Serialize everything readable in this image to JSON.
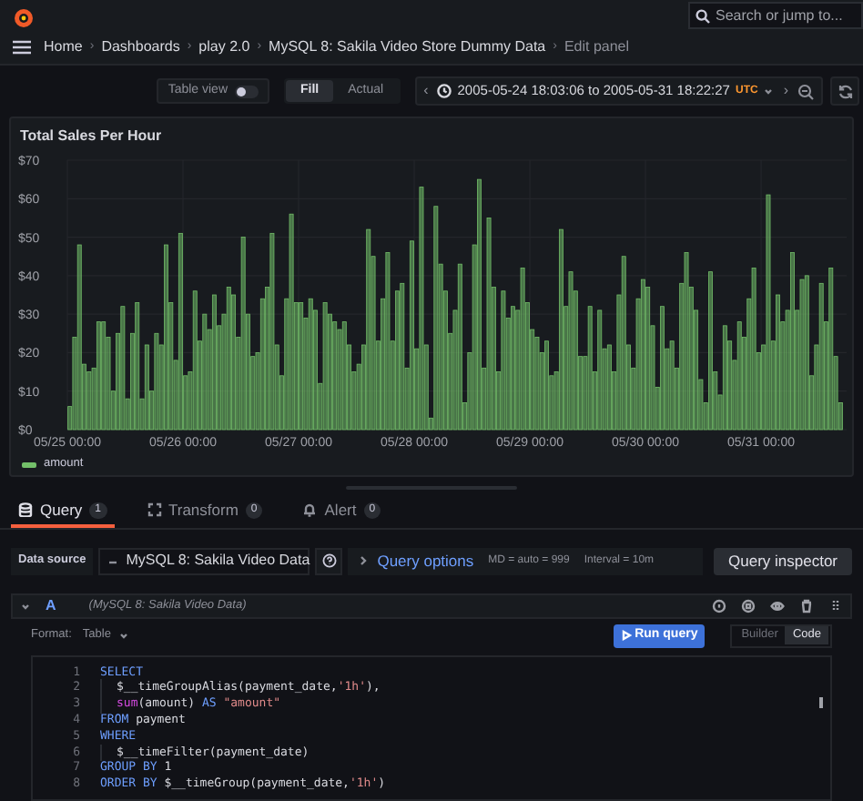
{
  "topbar": {
    "search": {
      "placeholder": "Search or jump to..."
    }
  },
  "breadcrumbs": [
    {
      "label": "Home"
    },
    {
      "separator": "›",
      "label": "Dashboards"
    },
    {
      "separator": "›",
      "label": "play 2.0"
    },
    {
      "separator": "›",
      "label": "MySQL 8: Sakila Video Store Dummy Data"
    },
    {
      "separator": "›",
      "label": "Edit panel"
    }
  ],
  "toolbar": {
    "table_view": {
      "label": "Table view",
      "on": false
    },
    "modes": [
      {
        "label": "Fill",
        "selected": true
      },
      {
        "label": "Actual",
        "selected": false
      }
    ],
    "time_range": {
      "prev": "‹",
      "text": "2005-05-24 18:03:06 to 2005-05-31 18:22:27",
      "timezone": "UTC",
      "next": "›"
    }
  },
  "panel": {
    "title": "Total Sales Per Hour",
    "chart_data": {
      "type": "bar",
      "categories": [
        "05/25 00:00",
        null,
        null,
        null,
        null,
        null,
        null,
        null,
        null,
        null,
        null,
        null,
        null,
        null,
        null,
        null,
        null,
        null,
        null,
        null,
        null,
        null,
        null,
        null,
        "05/26 00:00",
        null,
        null,
        null,
        null,
        null,
        null,
        null,
        null,
        null,
        null,
        null,
        null,
        null,
        null,
        null,
        null,
        null,
        null,
        null,
        null,
        null,
        null,
        null,
        "05/27 00:00",
        null,
        null,
        null,
        null,
        null,
        null,
        null,
        null,
        null,
        null,
        null,
        null,
        null,
        null,
        null,
        null,
        null,
        null,
        null,
        null,
        null,
        null,
        null,
        "05/28 00:00",
        null,
        null,
        null,
        null,
        null,
        null,
        null,
        null,
        null,
        null,
        null,
        null,
        null,
        null,
        null,
        null,
        null,
        null,
        null,
        null,
        null,
        null,
        null,
        "05/29 00:00",
        null,
        null,
        null,
        null,
        null,
        null,
        null,
        null,
        null,
        null,
        null,
        null,
        null,
        null,
        null,
        null,
        null,
        null,
        null,
        null,
        null,
        null,
        null,
        "05/30 00:00",
        null,
        null,
        null,
        null,
        null,
        null,
        null,
        null,
        null,
        null,
        null,
        null,
        null,
        null,
        null,
        null,
        null,
        null,
        null,
        null,
        null,
        null,
        null,
        "05/31 00:00",
        null,
        null,
        null,
        null,
        null,
        null,
        null,
        null,
        null,
        null,
        null,
        null,
        null,
        null,
        null,
        null
      ],
      "series": [
        {
          "name": "amount",
          "color": "#73bf69",
          "values": [
            6,
            24,
            48,
            17,
            15,
            16,
            28,
            28,
            24,
            10,
            25,
            32,
            8,
            25,
            33,
            8,
            22,
            10,
            25,
            22,
            48,
            33,
            18,
            51,
            14,
            15,
            36,
            23,
            30,
            26,
            35,
            27,
            30,
            37,
            35,
            24,
            50,
            30,
            19,
            20,
            34,
            37,
            51,
            22,
            14,
            34,
            56,
            33,
            33,
            29,
            34,
            31,
            12,
            33,
            30,
            28,
            26,
            28,
            22,
            15,
            17,
            22,
            52,
            45,
            23,
            34,
            46,
            23,
            36,
            38,
            16,
            49,
            21,
            63,
            22,
            3,
            58,
            43,
            36,
            25,
            31,
            43,
            7,
            20,
            48,
            65,
            16,
            55,
            37,
            15,
            36,
            29,
            32,
            31,
            42,
            33,
            26,
            24,
            20,
            23,
            14,
            15,
            52,
            32,
            41,
            36,
            19,
            19,
            32,
            15,
            31,
            21,
            22,
            15,
            35,
            45,
            22,
            16,
            34,
            39,
            37,
            27,
            11,
            32,
            21,
            23,
            16,
            38,
            46,
            37,
            31,
            13,
            7,
            41,
            15,
            9,
            27,
            23,
            18,
            28,
            24,
            34,
            42,
            20,
            22,
            61,
            23,
            35,
            28,
            31,
            46,
            31,
            39,
            40,
            14,
            22,
            38,
            28,
            42,
            19,
            7
          ]
        }
      ],
      "ylim": [
        0,
        70
      ],
      "grid": true,
      "yticks": [
        {
          "value": 0,
          "label": "$0"
        },
        {
          "value": 10,
          "label": "$10"
        },
        {
          "value": 20,
          "label": "$20"
        },
        {
          "value": 30,
          "label": "$30"
        },
        {
          "value": 40,
          "label": "$40"
        },
        {
          "value": 50,
          "label": "$50"
        },
        {
          "value": 60,
          "label": "$60"
        },
        {
          "value": 70,
          "label": "$70"
        }
      ]
    }
  },
  "tabs": [
    {
      "label": "Query",
      "count": "1",
      "selected": true
    },
    {
      "label": "Transform",
      "count": "0",
      "selected": false
    },
    {
      "label": "Alert",
      "count": "0",
      "selected": false
    }
  ],
  "query_bar": {
    "data_source_label": "Data source",
    "data_source": "MySQL 8: Sakila Video Data",
    "options_label": "Query options",
    "options_info": [
      "MD = auto = 999",
      "Interval = 10m"
    ],
    "inspector": "Query inspector"
  },
  "query": {
    "letter": "A",
    "source": "(MySQL 8: Sakila Video Data)",
    "format_label": "Format:",
    "format": "Table",
    "run": "Run query",
    "modes": [
      {
        "label": "Builder",
        "selected": false
      },
      {
        "label": "Code",
        "selected": true
      }
    ],
    "code": [
      {
        "number": "1",
        "tokens": [
          {
            "kind": "keyword",
            "text": "SELECT"
          }
        ]
      },
      {
        "number": "2",
        "indent": true,
        "tokens": [
          {
            "kind": "plain",
            "text": "$__timeGroupAlias(payment_date,"
          },
          {
            "kind": "string",
            "text": "'1h'"
          },
          {
            "kind": "plain",
            "text": "),"
          }
        ]
      },
      {
        "number": "3",
        "indent": true,
        "tokens": [
          {
            "kind": "func",
            "text": "sum"
          },
          {
            "kind": "plain",
            "text": "(amount) "
          },
          {
            "kind": "keyword",
            "text": "AS"
          },
          {
            "kind": "string",
            "text": " \"amount\""
          }
        ]
      },
      {
        "number": "4",
        "tokens": [
          {
            "kind": "keyword",
            "text": "FROM"
          },
          {
            "kind": "plain",
            "text": " payment"
          }
        ]
      },
      {
        "number": "5",
        "tokens": [
          {
            "kind": "keyword",
            "text": "WHERE"
          }
        ]
      },
      {
        "number": "6",
        "indent": true,
        "tokens": [
          {
            "kind": "plain",
            "text": "$__timeFilter(payment_date)"
          }
        ]
      },
      {
        "number": "7",
        "tokens": [
          {
            "kind": "keyword",
            "text": "GROUP BY"
          },
          {
            "kind": "plain",
            "text": " 1"
          }
        ]
      },
      {
        "number": "8",
        "tokens": [
          {
            "kind": "keyword",
            "text": "ORDER BY"
          },
          {
            "kind": "plain",
            "text": " $__timeGroup(payment_date,"
          },
          {
            "kind": "string",
            "text": "'1h'"
          },
          {
            "kind": "plain",
            "text": ")"
          }
        ]
      }
    ]
  }
}
